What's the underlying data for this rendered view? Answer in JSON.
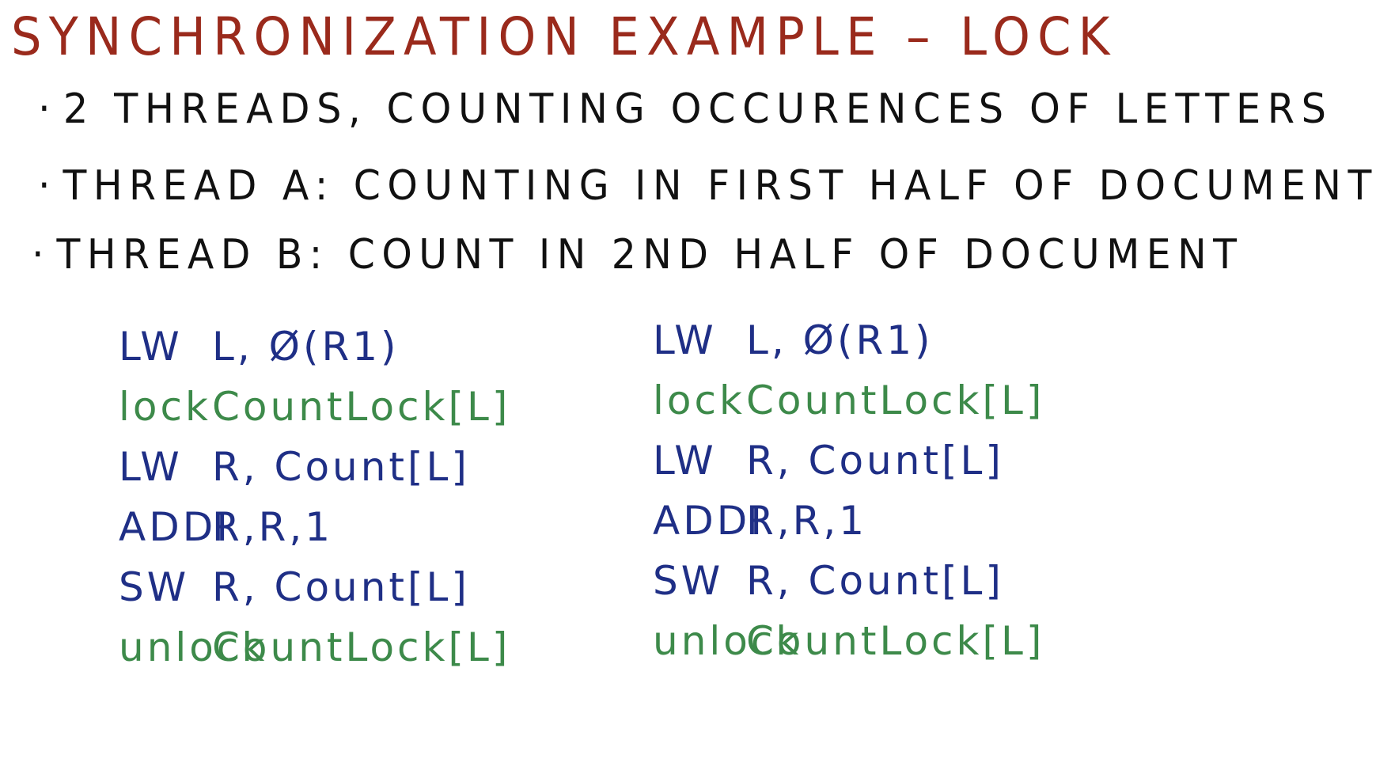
{
  "title": "SYNCHRONIZATION EXAMPLE – LOCK",
  "bullets": [
    "2 THREADS, COUNTING OCCURENCES OF LETTERS",
    "THREAD A: COUNTING IN FIRST HALF OF DOCUMENT",
    "THREAD B: COUNT IN 2ND HALF OF DOCUMENT"
  ],
  "thread_a_code": [
    {
      "op": "LW",
      "args": "L, Ø(R1)"
    },
    {
      "op": "lock",
      "args": "CountLock[L]"
    },
    {
      "op": "LW",
      "args": "R, Count[L]"
    },
    {
      "op": "ADDI",
      "args": "R,R,1"
    },
    {
      "op": "SW",
      "args": "R, Count[L]"
    },
    {
      "op": "unlock",
      "args": "CountLock[L]"
    }
  ],
  "thread_b_code": [
    {
      "op": "LW",
      "args": "L, Ø(R1)"
    },
    {
      "op": "lock",
      "args": "CountLock[L]"
    },
    {
      "op": "LW",
      "args": "R, Count[L]"
    },
    {
      "op": "ADDI",
      "args": "R,R,1"
    },
    {
      "op": "SW",
      "args": "R, Count[L]"
    },
    {
      "op": "unlock",
      "args": "CountLock[L]"
    }
  ],
  "colors": {
    "title": "#9a2a1c",
    "text": "#111111",
    "instruction": "#1f2f86",
    "lock_instruction": "#3d8a4a"
  }
}
